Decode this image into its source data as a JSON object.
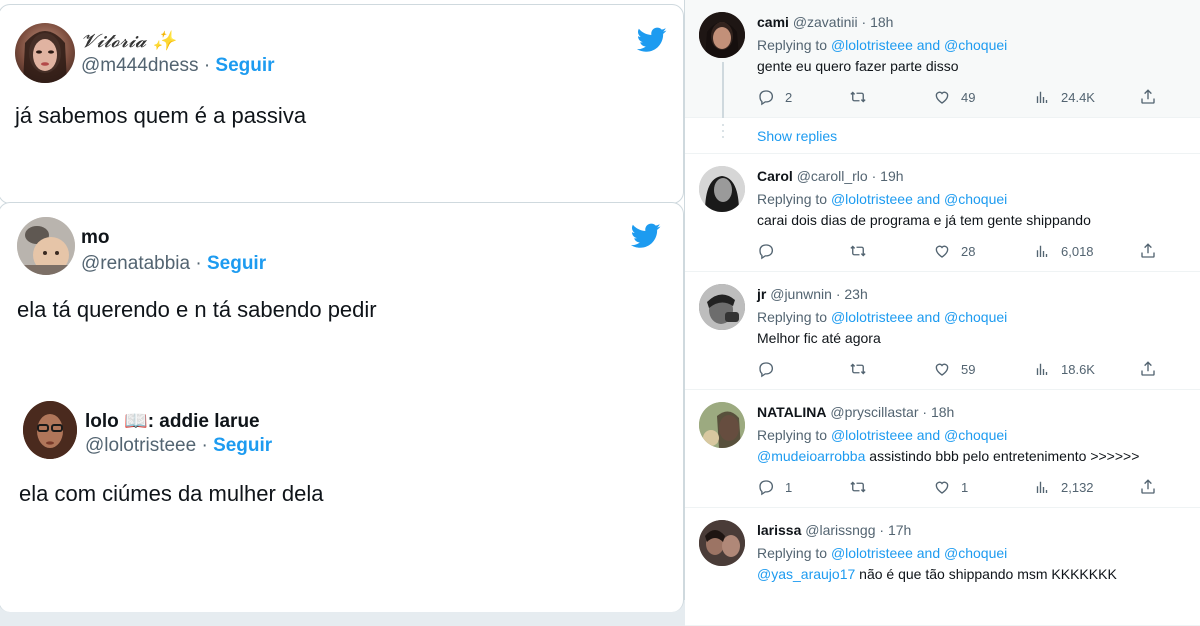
{
  "left_tweets": [
    {
      "name": "𝓥𝓲𝓽𝓸𝓻𝓲𝓪 ✨",
      "handle": "@m444dness",
      "follow": "Seguir",
      "text": "já sabemos quem é a passiva"
    },
    {
      "name": "mo",
      "handle": "@renatabbia",
      "follow": "Seguir",
      "text": "ela tá querendo e n tá sabendo pedir"
    },
    {
      "name": "lolo 📖: addie larue",
      "handle": "@lolotristeee",
      "follow": "Seguir",
      "text": "ela com ciúmes da mulher dela"
    }
  ],
  "separator_dot": "·",
  "replies": [
    {
      "name": "cami",
      "handle": "@zavatinii",
      "time": "18h",
      "replying_prefix": "Replying to",
      "mention1": "@lolotristeee",
      "and": "and",
      "mention2": "@choquei",
      "body_mention": "",
      "body": "gente eu quero fazer parte disso",
      "replies": "2",
      "retweets": "",
      "likes": "49",
      "views": "24.4K",
      "show_replies": "Show replies"
    },
    {
      "name": "Carol",
      "handle": "@caroll_rlo",
      "time": "19h",
      "replying_prefix": "Replying to",
      "mention1": "@lolotristeee",
      "and": "and",
      "mention2": "@choquei",
      "body_mention": "",
      "body": "carai dois dias de programa e já tem gente shippando",
      "replies": "",
      "retweets": "",
      "likes": "28",
      "views": "6,018"
    },
    {
      "name": "jr",
      "handle": "@junwnin",
      "time": "23h",
      "replying_prefix": "Replying to",
      "mention1": "@lolotristeee",
      "and": "and",
      "mention2": "@choquei",
      "body_mention": "",
      "body": "Melhor fic até agora",
      "replies": "",
      "retweets": "",
      "likes": "59",
      "views": "18.6K"
    },
    {
      "name": "NATALINA",
      "handle": "@pryscillastar",
      "time": "18h",
      "replying_prefix": "Replying to",
      "mention1": "@lolotristeee",
      "and": "and",
      "mention2": "@choquei",
      "body_mention": "@mudeioarrobba",
      "body": " assistindo bbb pelo entretenimento >>>>>>",
      "replies": "1",
      "retweets": "",
      "likes": "1",
      "views": "2,132"
    },
    {
      "name": "larissa",
      "handle": "@larissngg",
      "time": "17h",
      "replying_prefix": "Replying to",
      "mention1": "@lolotristeee",
      "and": "and",
      "mention2": "@choquei",
      "body_mention": "@yas_araujo17",
      "body": " não é que tão shippando msm KKKKKKK",
      "replies": "",
      "retweets": "",
      "likes": "",
      "views": ""
    }
  ],
  "colors": {
    "link": "#1d9bf0",
    "muted": "#536471",
    "text": "#0f1419",
    "border": "#cfd9de"
  }
}
